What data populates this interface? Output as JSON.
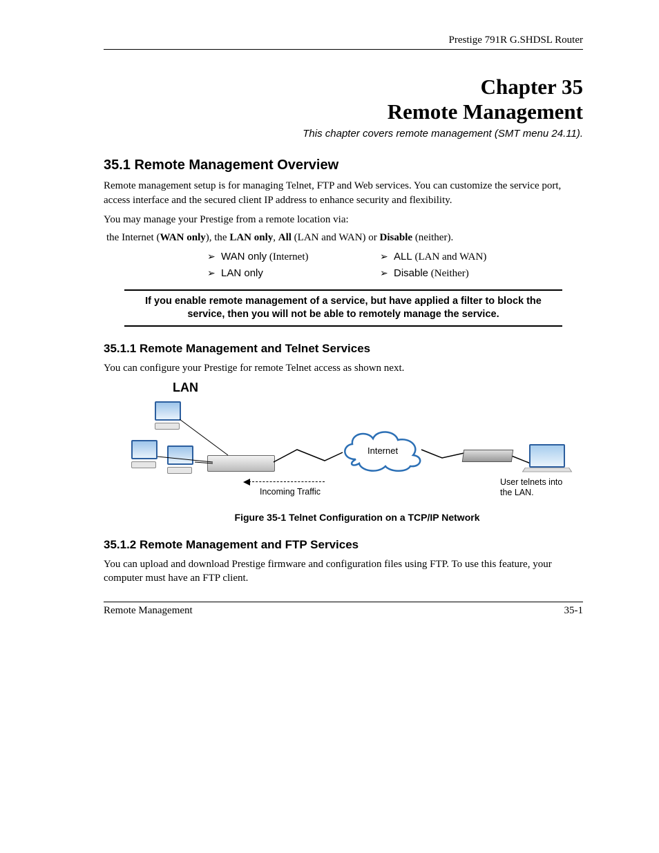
{
  "header": {
    "running_title": "Prestige 791R G.SHDSL Router"
  },
  "chapter": {
    "label": "Chapter 35",
    "title": "Remote Management",
    "subtitle": "This chapter covers remote management (SMT menu 24.11)."
  },
  "section_35_1": {
    "heading": "35.1  Remote Management Overview",
    "para1": "Remote management setup is for managing Telnet, FTP and Web services. You can customize the service port, access interface and the secured client IP address to enhance security and flexibility.",
    "para2": "You may manage your Prestige from a remote location via:",
    "option_line_pre": " the Internet (",
    "option_wan_only": "WAN only",
    "option_line_mid1": "), the ",
    "option_lan_only": "LAN only",
    "option_line_mid2": ", ",
    "option_all": "All",
    "option_line_mid3": " (LAN and WAN) or ",
    "option_disable": "Disable",
    "option_line_post": " (neither).",
    "bullets": [
      {
        "label": "WAN only",
        "paren": " (Internet)"
      },
      {
        "label": "ALL",
        "paren": " (LAN and WAN)"
      },
      {
        "label": "LAN only",
        "paren": ""
      },
      {
        "label": "Disable",
        "paren": " (Neither)"
      }
    ],
    "callout": "If you enable remote management of a service, but have applied a filter to block the service, then you will not be able to remotely manage the service."
  },
  "section_35_1_1": {
    "heading": "35.1.1 Remote Management and Telnet Services",
    "para": "You can configure your Prestige for remote Telnet access as shown next.",
    "figure_caption": "Figure 35-1 Telnet Configuration on a TCP/IP Network",
    "diagram": {
      "lan_label": "LAN",
      "cloud_label": "Internet",
      "incoming": "Incoming Traffic",
      "user_line1": "User telnets into",
      "user_line2": "the LAN."
    }
  },
  "section_35_1_2": {
    "heading": "35.1.2 Remote Management and FTP Services",
    "para": "You can upload and download Prestige firmware and configuration files using FTP. To use this feature, your computer must have an FTP client."
  },
  "footer": {
    "left": "Remote Management",
    "right": "35-1"
  }
}
